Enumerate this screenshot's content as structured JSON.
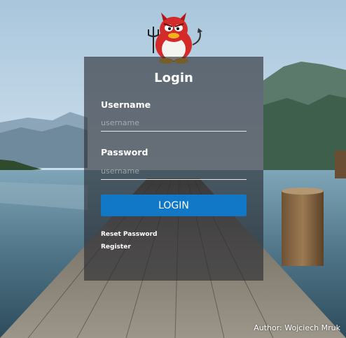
{
  "login": {
    "title": "Login",
    "username_label": "Username",
    "username_placeholder": "username",
    "password_label": "Password",
    "password_placeholder": "username",
    "login_button": "LOGIN",
    "reset_password_link": "Reset Password",
    "register_link": "Register"
  },
  "footer": {
    "author": "Author: Wojciech Mruk"
  },
  "colors": {
    "panel_overlay": "#282a30",
    "button": "#1177c7",
    "mascot_body": "#d42a2a"
  },
  "icons": {
    "mascot": "devil-penguin-logo"
  }
}
